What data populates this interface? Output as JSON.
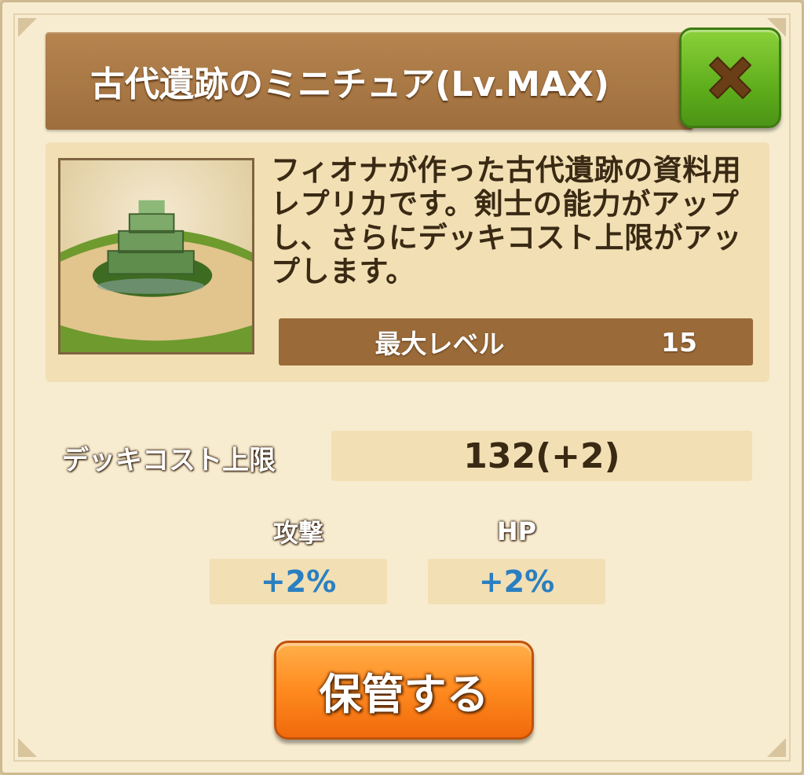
{
  "dialog": {
    "title": "古代遺跡のミニチュア(Lv.MAX)",
    "close_icon": "close-x-icon",
    "item_icon": "ancient-ruins-miniature-icon",
    "description": "フィオナが作った古代遺跡の資料用レプリカです。剣士の能力がアップし、さらにデッキコスト上限がアップします。"
  },
  "max_level": {
    "label": "最大レベル",
    "value": "15"
  },
  "deck_cost": {
    "label": "デッキコスト上限",
    "value": "132(+2)"
  },
  "stats": [
    {
      "label": "攻撃",
      "value": "+2%"
    },
    {
      "label": "HP",
      "value": "+2%"
    }
  ],
  "actions": {
    "store_label": "保管する"
  },
  "colors": {
    "title_bar": "#a8773f",
    "panel_bg": "#f7ecd0",
    "close_button": "#5fae1c",
    "store_button": "#ff8a1f",
    "stat_value_text": "#2a7fc1"
  }
}
